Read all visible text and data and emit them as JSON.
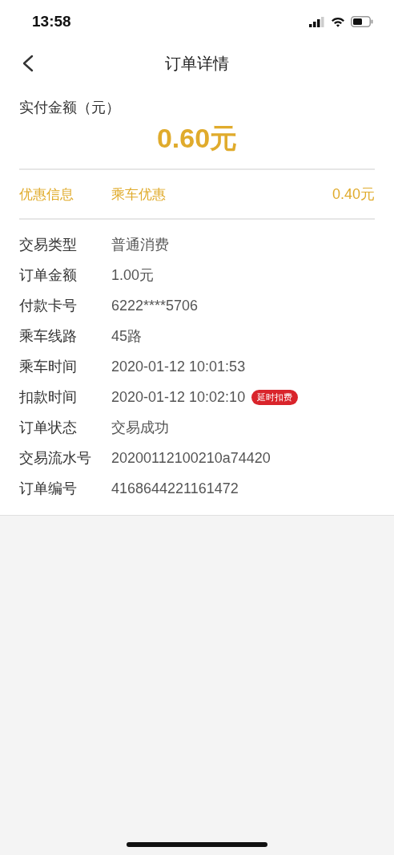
{
  "status_bar": {
    "time": "13:58"
  },
  "nav": {
    "title": "订单详情"
  },
  "payment": {
    "label": "实付金额（元）",
    "amount": "0.60元"
  },
  "discount": {
    "label": "优惠信息",
    "name": "乘车优惠",
    "amount": "0.40元"
  },
  "details": [
    {
      "label": "交易类型",
      "value": "普通消费"
    },
    {
      "label": "订单金额",
      "value": "1.00元"
    },
    {
      "label": "付款卡号",
      "value": "6222****5706"
    },
    {
      "label": "乘车线路",
      "value": "45路"
    },
    {
      "label": "乘车时间",
      "value": "2020-01-12 10:01:53"
    },
    {
      "label": "扣款时间",
      "value": "2020-01-12 10:02:10",
      "badge": "延时扣费"
    },
    {
      "label": "订单状态",
      "value": "交易成功"
    },
    {
      "label": "交易流水号",
      "value": "20200112100210a74420"
    },
    {
      "label": "订单编号",
      "value": "4168644221161472"
    }
  ]
}
